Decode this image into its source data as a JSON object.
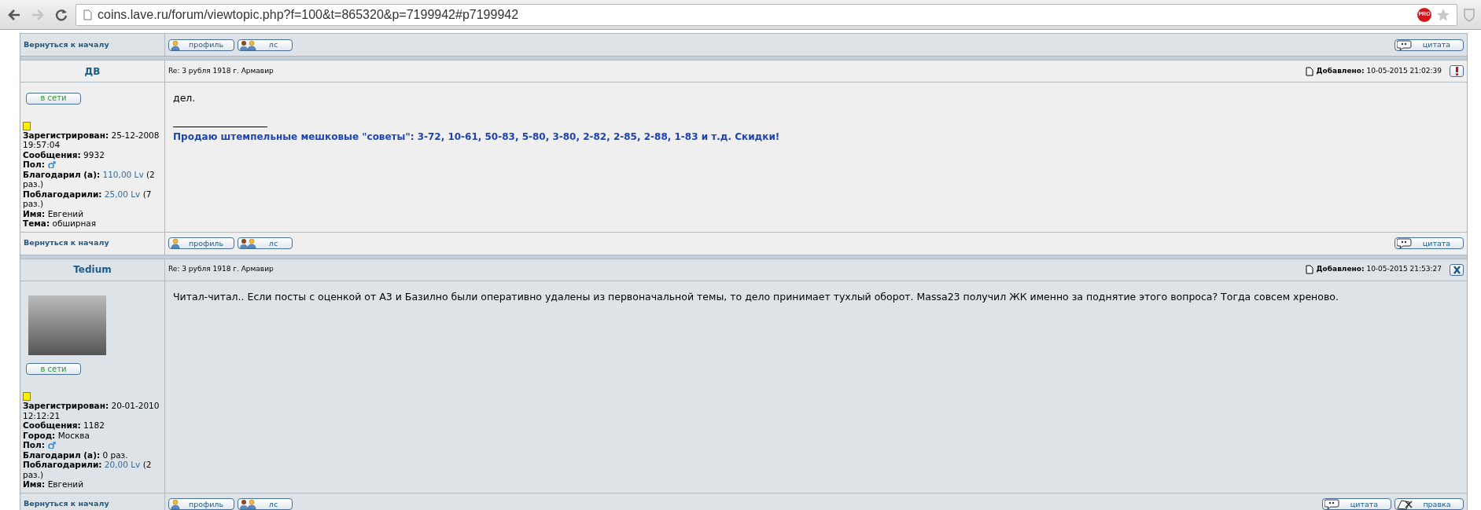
{
  "browser": {
    "url": "coins.lave.ru/forum/viewtopic.php?f=100&t=865320&p=7199942#p7199942",
    "forward_disabled": true,
    "extension_badge": "PRO"
  },
  "previous_post_footer": {
    "back_link": "Вернуться к началу",
    "buttons": [
      {
        "kind": "profile",
        "label": "профиль"
      },
      {
        "kind": "pm",
        "label": "лс"
      },
      {
        "kind": "quote",
        "label": "цитата"
      }
    ]
  },
  "posts": [
    {
      "author": "ДВ",
      "subject": "Re: 3 рубля 1918 г. Армавир",
      "added_label": "Добавлено:",
      "added_value": "10-05-2015 21:02:39",
      "header_button": {
        "kind": "report"
      },
      "has_avatar": false,
      "online_label": "в сети",
      "rank": {
        "color": "#ffee00"
      },
      "fields": [
        {
          "kind": "text",
          "label": "Зарегистрирован:",
          "value": "25-12-2008 19:57:04"
        },
        {
          "kind": "text",
          "label": "Сообщения:",
          "value": "9932"
        },
        {
          "kind": "gender",
          "label": "Пол:"
        },
        {
          "kind": "money",
          "label": "Благодарил (а):",
          "amount": "110,00 Lv",
          "count": "(2 раз.)"
        },
        {
          "kind": "money",
          "label": "Поблагодарили:",
          "amount": "25,00 Lv",
          "count": "(7 раз.)"
        },
        {
          "kind": "text",
          "label": "Имя:",
          "value": "Евгений"
        },
        {
          "kind": "text",
          "label": "Тема:",
          "value": "обширная"
        }
      ],
      "body": "дел.",
      "signature": "Продаю штемпельные мешковые \"советы\": 3-72, 10-61, 50-83, 5-80, 3-80, 2-82, 2-85, 2-88, 1-83 и т.д. Скидки!",
      "back_link": "Вернуться к началу",
      "buttons": [
        {
          "kind": "profile",
          "label": "профиль"
        },
        {
          "kind": "pm",
          "label": "лс"
        },
        {
          "kind": "quote",
          "label": "цитата"
        }
      ]
    },
    {
      "author": "Tedium",
      "subject": "Re: 3 рубля 1918 г. Армавир",
      "added_label": "Добавлено:",
      "added_value": "10-05-2015 21:53:27",
      "header_button": {
        "kind": "delete"
      },
      "has_avatar": true,
      "online_label": "в сети",
      "rank": {
        "color": "#ffee00"
      },
      "fields": [
        {
          "kind": "text",
          "label": "Зарегистрирован:",
          "value": "20-01-2010 12:12:21"
        },
        {
          "kind": "text",
          "label": "Сообщения:",
          "value": "1182"
        },
        {
          "kind": "text",
          "label": "Город:",
          "value": "Москва"
        },
        {
          "kind": "gender",
          "label": "Пол:"
        },
        {
          "kind": "text",
          "label": "Благодарил (а):",
          "value": "0 раз."
        },
        {
          "kind": "money",
          "label": "Поблагодарили:",
          "amount": "20,00 Lv",
          "count": "(2 раз.)"
        },
        {
          "kind": "text",
          "label": "Имя:",
          "value": "Евгений"
        }
      ],
      "body": "Читал-читал.. Если посты с оценкой от А3 и Базилно были оперативно удалены из первоначальной темы, то дело принимает тухлый оборот. Massa23 получил ЖК именно за поднятие этого вопроса? Тогда совсем хреново.",
      "back_link": "Вернуться к началу",
      "buttons": [
        {
          "kind": "profile",
          "label": "профиль"
        },
        {
          "kind": "pm",
          "label": "лс"
        },
        {
          "kind": "quote",
          "label": "цитата"
        },
        {
          "kind": "edit",
          "label": "правка"
        }
      ]
    }
  ]
}
